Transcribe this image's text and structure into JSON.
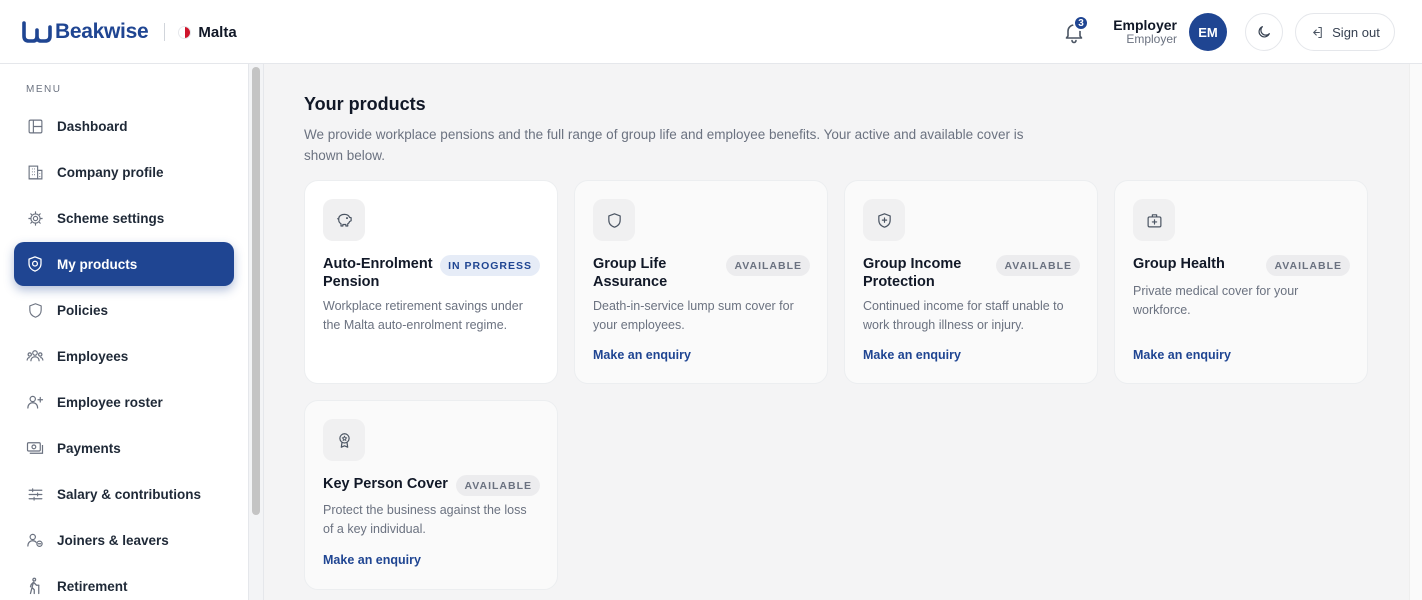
{
  "brand": {
    "name": "Beakwise",
    "country": "Malta"
  },
  "header": {
    "notification_count": "3",
    "user_name": "Employer",
    "user_role": "Employer",
    "avatar_initials": "EM",
    "theme_icon": "moon-icon",
    "signout_label": "Sign out"
  },
  "sidebar": {
    "menu_label": "MENU",
    "items": [
      {
        "label": "Dashboard",
        "icon": "dashboard-icon"
      },
      {
        "label": "Company profile",
        "icon": "building-icon"
      },
      {
        "label": "Scheme settings",
        "icon": "settings-icon"
      },
      {
        "label": "My products",
        "icon": "shield-check-icon",
        "active": true
      },
      {
        "label": "Policies",
        "icon": "shield-icon"
      },
      {
        "label": "Employees",
        "icon": "users-icon"
      },
      {
        "label": "Employee roster",
        "icon": "user-plus-icon"
      },
      {
        "label": "Payments",
        "icon": "banknote-icon"
      },
      {
        "label": "Salary & contributions",
        "icon": "sliders-icon"
      },
      {
        "label": "Joiners & leavers",
        "icon": "user-switch-icon"
      },
      {
        "label": "Retirement",
        "icon": "walking-person-icon"
      }
    ]
  },
  "main": {
    "title": "Your products",
    "description": "We provide workplace pensions and the full range of group life and employee benefits. Your active and available cover is shown below.",
    "products": [
      {
        "title": "Auto-Enrolment Pension",
        "status": "IN PROGRESS",
        "description": "Workplace retirement savings under the Malta auto-enrolment regime.",
        "link": "",
        "icon": "piggy-bank-icon"
      },
      {
        "title": "Group Life Assurance",
        "status": "AVAILABLE",
        "description": "Death-in-service lump sum cover for your employees.",
        "link": "Make an enquiry",
        "icon": "shield-icon"
      },
      {
        "title": "Group Income Protection",
        "status": "AVAILABLE",
        "description": "Continued income for staff unable to work through illness or injury.",
        "link": "Make an enquiry",
        "icon": "shield-plus-icon"
      },
      {
        "title": "Group Health",
        "status": "AVAILABLE",
        "description": "Private medical cover for your workforce.",
        "link": "Make an enquiry",
        "icon": "medical-bag-icon"
      },
      {
        "title": "Key Person Cover",
        "status": "AVAILABLE",
        "description": "Protect the business against the loss of a key individual.",
        "link": "Make an enquiry",
        "icon": "award-icon"
      }
    ]
  }
}
